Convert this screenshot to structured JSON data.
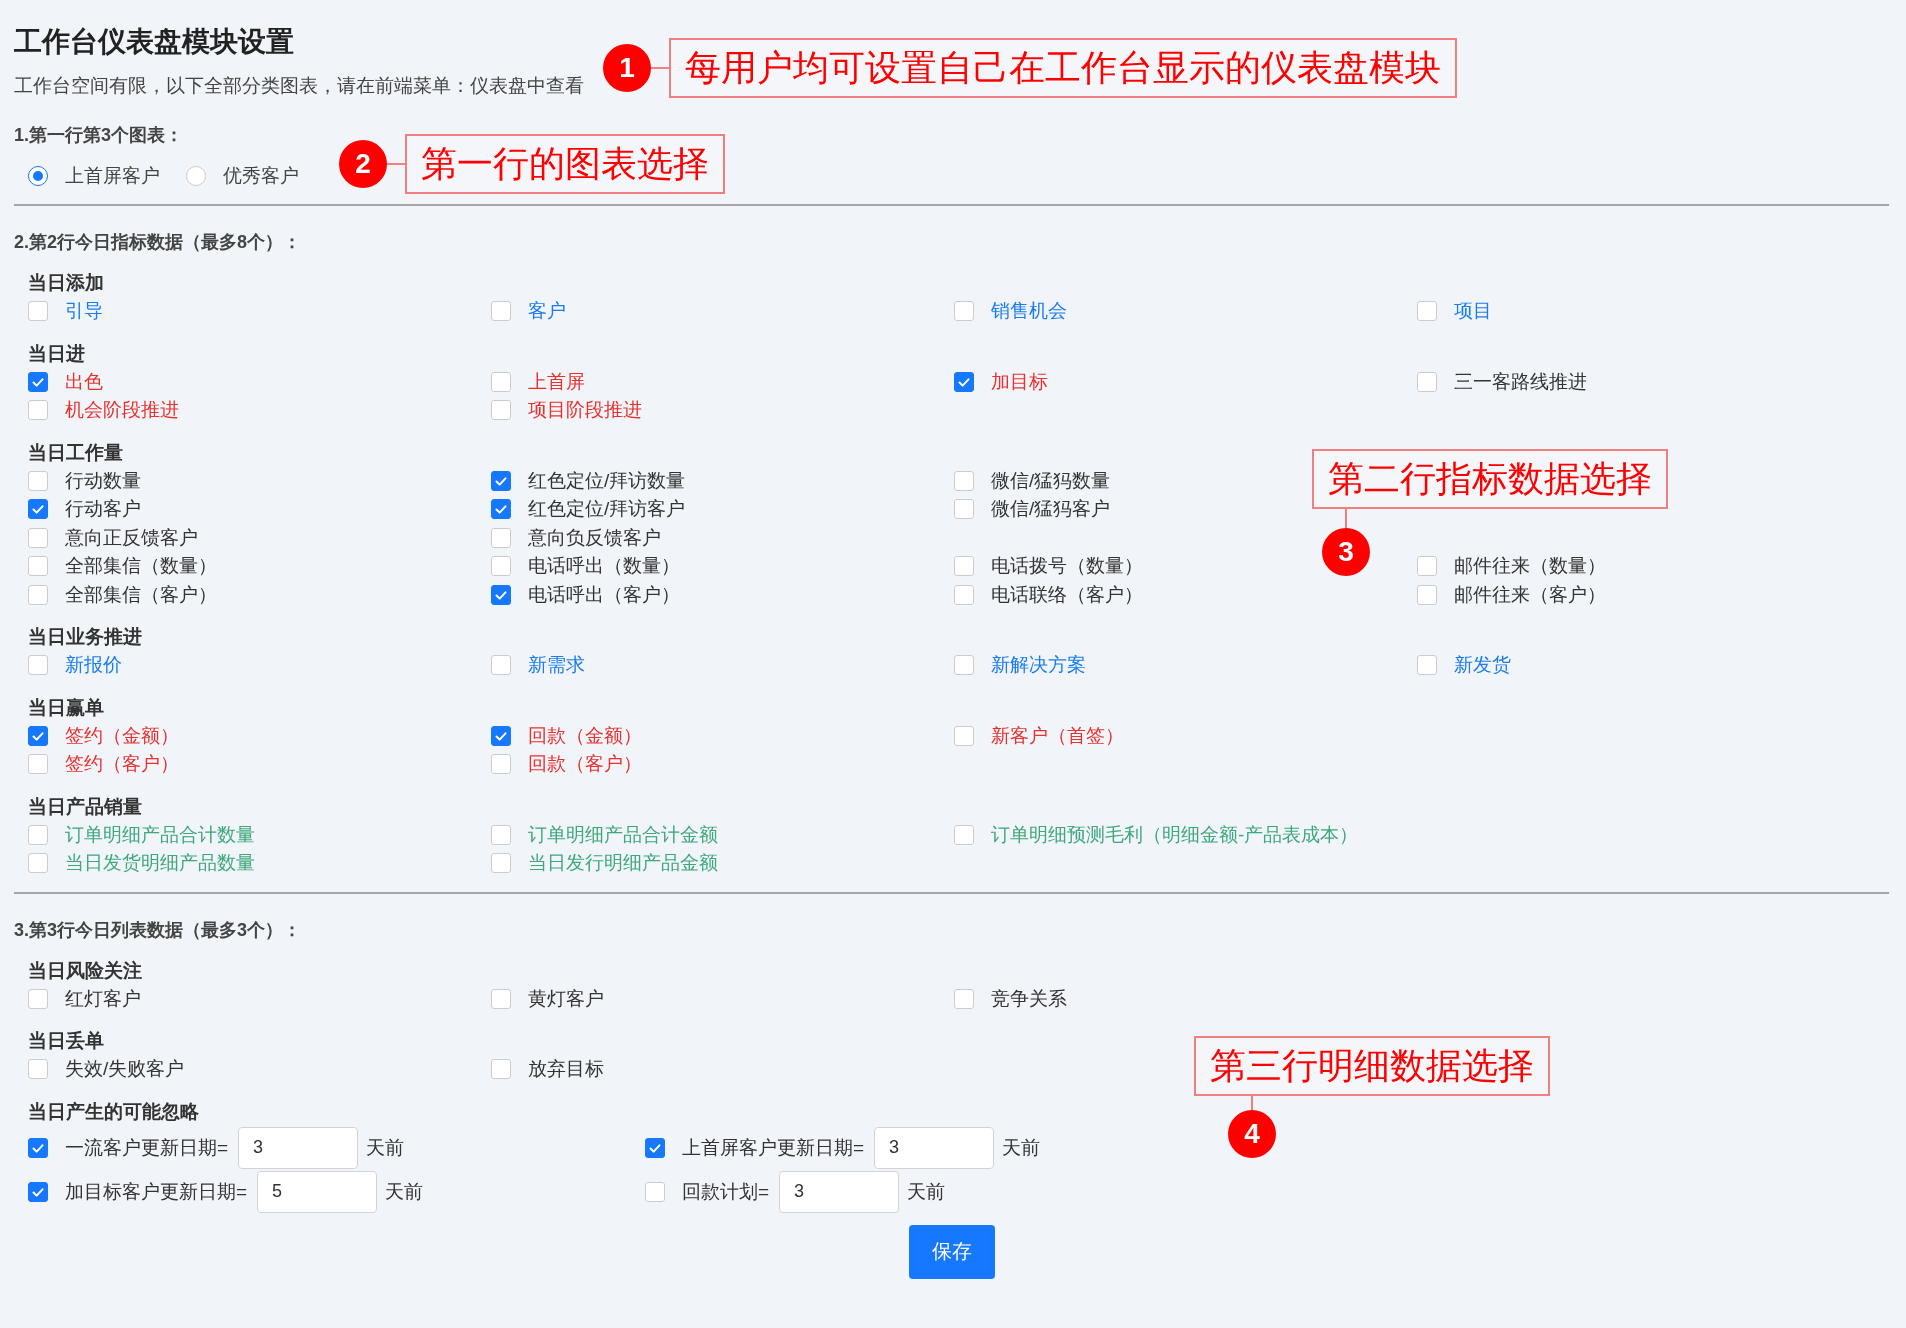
{
  "page": {
    "title": "工作台仪表盘模块设置",
    "subtitle": "工作台空间有限，以下全部分类图表，请在前端菜单：仪表盘中查看"
  },
  "section1": {
    "label": "1.第一行第3个图表：",
    "options": [
      {
        "label": "上首屏客户",
        "selected": true
      },
      {
        "label": "优秀客户",
        "selected": false
      }
    ]
  },
  "section2": {
    "label": "2.第2行今日指标数据（最多8个）：",
    "groups": [
      {
        "title": "当日添加",
        "rows": [
          [
            {
              "label": "引导",
              "checked": false,
              "color": "#1a7cf0"
            },
            {
              "label": "客户",
              "checked": false,
              "color": "#1a7cf0"
            },
            {
              "label": "销售机会",
              "checked": false,
              "color": "#1a7cf0"
            },
            {
              "label": "项目",
              "checked": false,
              "color": "#1a7cf0"
            }
          ]
        ]
      },
      {
        "title": "当日进",
        "rows": [
          [
            {
              "label": "出色",
              "checked": true,
              "color": "#e8312f"
            },
            {
              "label": "上首屏",
              "checked": false,
              "color": "#e8312f"
            },
            {
              "label": "加目标",
              "checked": true,
              "color": "#e8312f"
            },
            {
              "label": "三一客路线推进",
              "checked": false,
              "color": "#333333"
            }
          ],
          [
            {
              "label": "机会阶段推进",
              "checked": false,
              "color": "#e8312f"
            },
            {
              "label": "项目阶段推进",
              "checked": false,
              "color": "#e8312f"
            }
          ]
        ]
      },
      {
        "title": "当日工作量",
        "rows": [
          [
            {
              "label": "行动数量",
              "checked": false,
              "color": "#333333"
            },
            {
              "label": "红色定位/拜访数量",
              "checked": true,
              "color": "#333333"
            },
            {
              "label": "微信/猛犸数量",
              "checked": false,
              "color": "#333333"
            }
          ],
          [
            {
              "label": "行动客户",
              "checked": true,
              "color": "#333333"
            },
            {
              "label": "红色定位/拜访客户",
              "checked": true,
              "color": "#333333"
            },
            {
              "label": "微信/猛犸客户",
              "checked": false,
              "color": "#333333"
            }
          ],
          [
            {
              "label": "意向正反馈客户",
              "checked": false,
              "color": "#333333"
            },
            {
              "label": "意向负反馈客户",
              "checked": false,
              "color": "#333333"
            }
          ],
          [
            {
              "label": "全部集信（数量）",
              "checked": false,
              "color": "#333333"
            },
            {
              "label": "电话呼出（数量）",
              "checked": false,
              "color": "#333333"
            },
            {
              "label": "电话拨号（数量）",
              "checked": false,
              "color": "#333333"
            },
            {
              "label": "邮件往来（数量）",
              "checked": false,
              "color": "#333333"
            }
          ],
          [
            {
              "label": "全部集信（客户）",
              "checked": false,
              "color": "#333333"
            },
            {
              "label": "电话呼出（客户）",
              "checked": true,
              "color": "#333333"
            },
            {
              "label": "电话联络（客户）",
              "checked": false,
              "color": "#333333"
            },
            {
              "label": "邮件往来（客户）",
              "checked": false,
              "color": "#333333"
            }
          ]
        ]
      },
      {
        "title": "当日业务推进",
        "rows": [
          [
            {
              "label": "新报价",
              "checked": false,
              "color": "#1a7cf0"
            },
            {
              "label": "新需求",
              "checked": false,
              "color": "#1a7cf0"
            },
            {
              "label": "新解决方案",
              "checked": false,
              "color": "#1a7cf0"
            },
            {
              "label": "新发货",
              "checked": false,
              "color": "#1a7cf0"
            }
          ]
        ]
      },
      {
        "title": "当日赢单",
        "rows": [
          [
            {
              "label": "签约（金额）",
              "checked": true,
              "color": "#e8312f"
            },
            {
              "label": "回款（金额）",
              "checked": true,
              "color": "#e8312f"
            },
            {
              "label": "新客户（首签）",
              "checked": false,
              "color": "#e8312f"
            }
          ],
          [
            {
              "label": "签约（客户）",
              "checked": false,
              "color": "#e8312f"
            },
            {
              "label": "回款（客户）",
              "checked": false,
              "color": "#e8312f"
            }
          ]
        ]
      },
      {
        "title": "当日产品销量",
        "rows": [
          [
            {
              "label": "订单明细产品合计数量",
              "checked": false,
              "color": "#3ea77c"
            },
            {
              "label": "订单明细产品合计金额",
              "checked": false,
              "color": "#3ea77c"
            },
            {
              "label": "订单明细预测毛利（明细金额-产品表成本）",
              "checked": false,
              "color": "#3ea77c"
            }
          ],
          [
            {
              "label": "当日发货明细产品数量",
              "checked": false,
              "color": "#3ea77c"
            },
            {
              "label": "当日发行明细产品金额",
              "checked": false,
              "color": "#3ea77c"
            }
          ]
        ]
      }
    ]
  },
  "section3": {
    "label": "3.第3行今日列表数据（最多3个）：",
    "groups": [
      {
        "title": "当日风险关注",
        "rows": [
          [
            {
              "label": "红灯客户",
              "checked": false,
              "color": "#333333"
            },
            {
              "label": "黄灯客户",
              "checked": false,
              "color": "#333333"
            },
            {
              "label": "竞争关系",
              "checked": false,
              "color": "#333333"
            }
          ]
        ]
      },
      {
        "title": "当日丢单",
        "rows": [
          [
            {
              "label": "失效/失败客户",
              "checked": false,
              "color": "#333333"
            },
            {
              "label": "放弃目标",
              "checked": false,
              "color": "#333333"
            }
          ]
        ]
      }
    ],
    "input_group": {
      "title": "当日产生的可能忽略",
      "items": [
        {
          "label": "一流客户更新日期=",
          "checked": true,
          "value": "3",
          "suffix": "天前"
        },
        {
          "label": "上首屏客户更新日期=",
          "checked": true,
          "value": "3",
          "suffix": "天前"
        },
        {
          "label": "加目标客户更新日期=",
          "checked": true,
          "value": "5",
          "suffix": "天前"
        },
        {
          "label": "回款计划=",
          "checked": false,
          "value": "3",
          "suffix": "天前"
        }
      ]
    }
  },
  "save_button": "保存",
  "callouts": [
    {
      "number": "1",
      "text": "每用户均可设置自己在工作台显示的仪表盘模块"
    },
    {
      "number": "2",
      "text": "第一行的图表选择"
    },
    {
      "number": "3",
      "text": "第二行指标数据选择"
    },
    {
      "number": "4",
      "text": "第三行明细数据选择"
    }
  ]
}
